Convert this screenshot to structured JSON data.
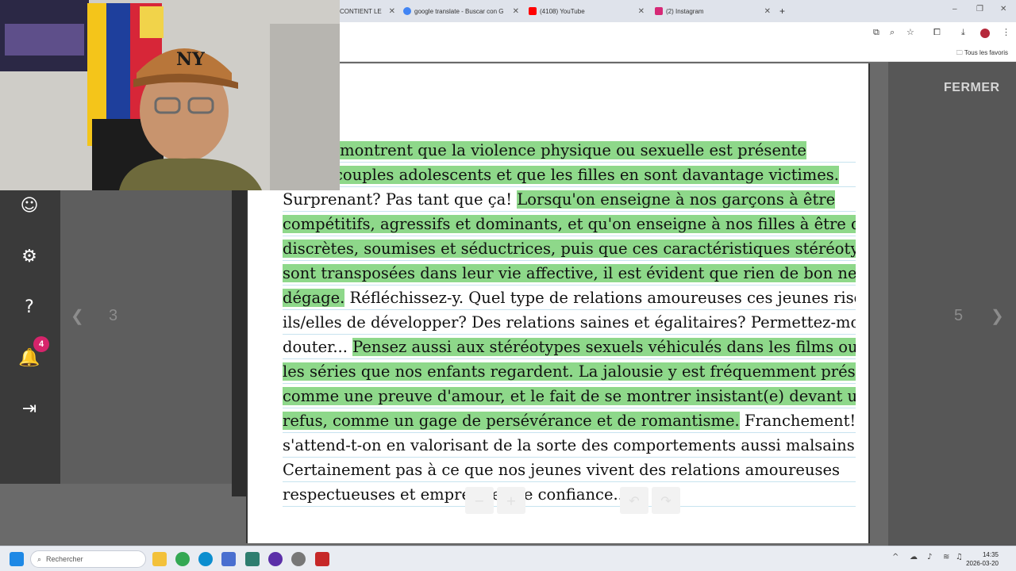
{
  "browser": {
    "tabs": [
      {
        "title": "CONTIENT LE",
        "favicon_color": "#1a73e8"
      },
      {
        "title": "google translate - Buscar con G",
        "favicon_color": "#4285f4"
      },
      {
        "title": "(4108) YouTube",
        "favicon_color": "#ff0000"
      },
      {
        "title": "(2) Instagram",
        "favicon_color": "#d62976"
      }
    ],
    "new_tab_label": "+",
    "bookmarks_all_label": "Tous les favoris"
  },
  "viewer": {
    "close_label": "FERMER",
    "prev_page": "3",
    "next_page": "5",
    "prev_arrow": "❮",
    "next_arrow": "❯"
  },
  "sidebar": {
    "notification_count": "4"
  },
  "document": {
    "lines": [
      [
        {
          "t": "études montrent que la violence physique ou sexuelle est présente",
          "hl": true
        }
      ],
      [
        {
          "t": "% des couples adolescents et que les filles en sont davantage victimes.",
          "hl": true
        }
      ],
      [
        {
          "t": "Surprenant? Pas tant que ça! ",
          "hl": false
        },
        {
          "t": "Lorsqu'on enseigne à nos garçons à être",
          "hl": true
        }
      ],
      [
        {
          "t": "compétitifs, agressifs et dominants, et qu'on enseigne à nos filles à être douces,",
          "hl": true
        }
      ],
      [
        {
          "t": "discrètes, soumises et séductrices, puis que ces caractéristiques stéréotypées",
          "hl": true
        }
      ],
      [
        {
          "t": "sont transposées dans leur vie affective, il est évident que rien de bon ne s'en",
          "hl": true
        }
      ],
      [
        {
          "t": "dégage.",
          "hl": true
        },
        {
          "t": " Réfléchissez-y. Quel type de relations amoureuses ces jeunes risquent-",
          "hl": false
        }
      ],
      [
        {
          "t": "ils/elles de développer? Des relations saines et égalitaires? Permettez-moi d'en",
          "hl": false
        }
      ],
      [
        {
          "t": "douter... ",
          "hl": false
        },
        {
          "t": "Pensez aussi aux stéréotypes sexuels véhiculés dans les films ou dans",
          "hl": true
        }
      ],
      [
        {
          "t": "les séries que nos enfants regardent. La jalousie y est fréquemment présentée",
          "hl": true
        }
      ],
      [
        {
          "t": "comme une preuve d'amour, et le fait de se montrer insistant(e) devant un",
          "hl": true
        }
      ],
      [
        {
          "t": "refus, comme un gage de persévérance et de romantisme.",
          "hl": true
        },
        {
          "t": " Franchement! À quoi",
          "hl": false
        }
      ],
      [
        {
          "t": "s'attend-t-on en valorisant de la sorte des comportements aussi malsains?",
          "hl": false
        }
      ],
      [
        {
          "t": "Certainement pas à ce que nos jeunes vivent des relations amoureuses",
          "hl": false
        }
      ],
      [
        {
          "t": "respectueuses et empreintes de confiance...",
          "hl": false
        }
      ]
    ]
  },
  "taskbar": {
    "search_placeholder": "Rechercher",
    "time": "14:35",
    "date": "2026-03-20"
  },
  "colors": {
    "highlight": "#8ed88a",
    "badge": "#d6246b",
    "sidebar": "#3a3a3a"
  }
}
